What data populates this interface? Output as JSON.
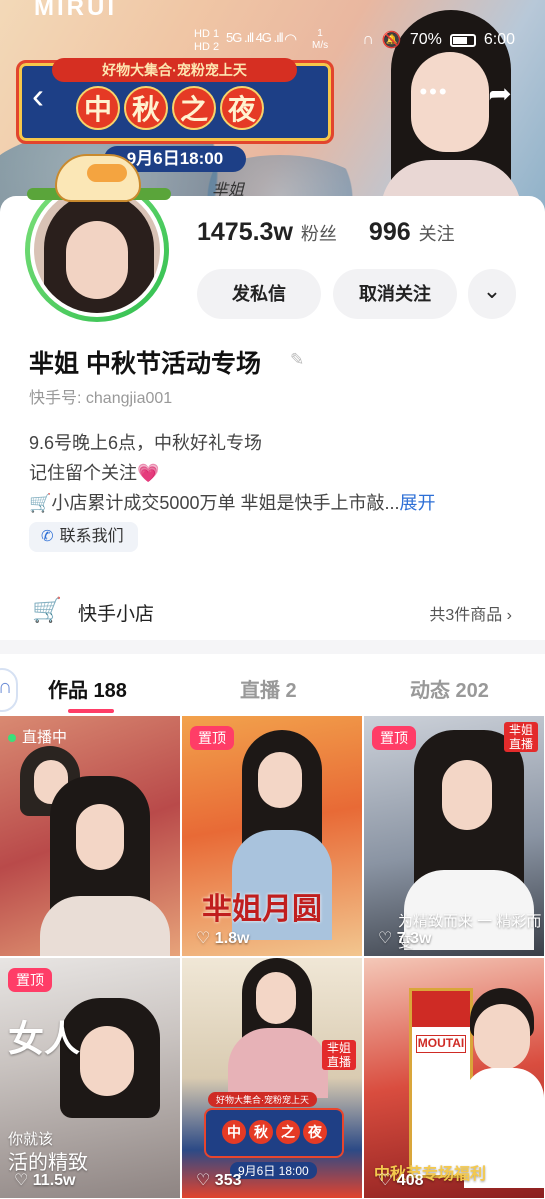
{
  "banner": {
    "brand": "MIRUI",
    "event_sub": "好物大集合·宠粉宠上天",
    "event_title_chars": [
      "中",
      "秋",
      "之",
      "夜"
    ],
    "event_date": "9月6日18:00",
    "signature": "芈姐"
  },
  "status_bar": {
    "sim": "HD 1\nHD 2",
    "signal": "5G .ıll 4G .ıll",
    "wifi_icon": "wifi-icon",
    "net_speed": "1\nM/s",
    "battery_pct": "70%",
    "battery_level": 0.7,
    "time": "6:00"
  },
  "nav": {
    "back_icon": "back-chevron-icon",
    "more_label": "•••",
    "share_icon": "share-arrow-icon"
  },
  "profile": {
    "followers_count": "1475.3w",
    "followers_label": "粉丝",
    "following_count": "996",
    "following_label": "关注",
    "message_button": "发私信",
    "unfollow_button": "取消关注",
    "dropdown_icon": "chevron-down-icon",
    "name": "芈姐 中秋节活动专场",
    "id_label": "快手号: changjia001",
    "bio_line1": "9.6号晚上6点，中秋好礼专场",
    "bio_line2": "记住留个关注",
    "bio_line3": "小店累计成交5000万单 芈姐是快手上市敲...",
    "bio_expand": "展开",
    "contact_label": "联系我们"
  },
  "shop": {
    "title": "快手小店",
    "count": "共3件商品"
  },
  "tabs": [
    {
      "label": "作品 188",
      "active": true
    },
    {
      "label": "直播 2",
      "active": false
    },
    {
      "label": "动态 202",
      "active": false
    }
  ],
  "grid": [
    {
      "badge": "直播中",
      "likes": ""
    },
    {
      "badge": "置顶",
      "likes": "♡ 1.8w",
      "overlay": "芈姐月圆"
    },
    {
      "badge": "置顶",
      "likes": "♡ 7.3w",
      "overlay": "为精致而来 一 精彩而变",
      "corner": "芈姐\n直播"
    },
    {
      "badge": "置顶",
      "likes": "♡ 11.5w",
      "overlay_big": "女人",
      "overlay_small1": "你就该",
      "overlay_small2": "活的精致"
    },
    {
      "badge": "",
      "likes": "♡ 353",
      "promo_sub": "好物大集合·宠粉宠上天",
      "promo_chars": [
        "中",
        "秋",
        "之",
        "夜"
      ],
      "promo_date": "9月6日 18:00",
      "corner": "芈姐\n直播"
    },
    {
      "badge": "",
      "likes": "♡ 408",
      "overlay": "中秋节专场福利",
      "bottle_label": "MOUTAI"
    }
  ]
}
